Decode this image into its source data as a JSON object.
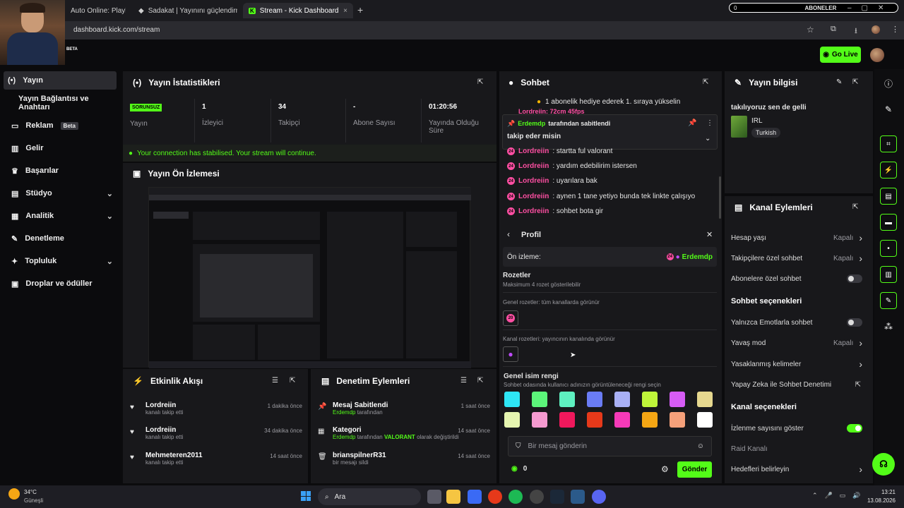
{
  "browser": {
    "tabs": [
      {
        "label": "Auto Online: Playli"
      },
      {
        "label": "Sadakat | Yayınını güçlendirmek"
      },
      {
        "label": "Stream - Kick Dashboard"
      }
    ],
    "url": "dashboard.kick.com/stream",
    "subscriber_overlay": {
      "count": "0",
      "label": "ABONELER"
    }
  },
  "header": {
    "beta_label": "BETA",
    "go_live": "Go Live"
  },
  "sidenav": [
    {
      "label": "Yayın",
      "icon": "broadcast-icon"
    },
    {
      "label": "Yayın Bağlantısı ve Anahtarı"
    },
    {
      "label": "Reklam",
      "badge": "Beta",
      "icon": "ad-icon"
    },
    {
      "label": "Gelir",
      "icon": "revenue-icon"
    },
    {
      "label": "Başarılar",
      "icon": "trophy-icon"
    },
    {
      "label": "Stüdyo",
      "icon": "studio-icon"
    },
    {
      "label": "Analitik",
      "icon": "analytics-icon"
    },
    {
      "label": "Denetleme",
      "icon": "wrench-icon"
    },
    {
      "label": "Topluluk",
      "icon": "community-icon"
    },
    {
      "label": "Droplar ve ödüller",
      "icon": "drops-icon"
    }
  ],
  "stats": {
    "title": "Yayın İstatistikleri",
    "cells": [
      {
        "value": "SORUNSUZ",
        "label": "Yayın"
      },
      {
        "value": "1",
        "label": "İzleyici"
      },
      {
        "value": "34",
        "label": "Takipçi"
      },
      {
        "value": "-",
        "label": "Abone Sayısı"
      },
      {
        "value": "01:20:56",
        "label": "Yayında Olduğu Süre"
      }
    ],
    "connection": "Your connection has stabilised. Your stream will continue."
  },
  "preview": {
    "title": "Yayın Ön İzlemesi"
  },
  "activity": {
    "title": "Etkinlik Akışı",
    "items": [
      {
        "name": "Lordreiin",
        "action": "kanalı takip etti",
        "time": "1 dakika önce"
      },
      {
        "name": "Lordreiin",
        "action": "kanalı takip etti",
        "time": "34 dakika önce"
      },
      {
        "name": "Mehmeteren2011",
        "action": "kanalı takip etti",
        "time": "14 saat önce"
      }
    ]
  },
  "moderation": {
    "title": "Denetim Eylemleri",
    "items": [
      {
        "title": "Mesaj Sabitlendi",
        "by": "Erdemdp",
        "suffix": "tarafından",
        "time": "1 saat önce"
      },
      {
        "title": "Kategori",
        "by": "Erdemdp",
        "suffix": "tarafından",
        "cat": "VALORANT",
        "suffix2": "olarak değiştirildi",
        "time": "14 saat önce"
      },
      {
        "title": "brianspilnerR31",
        "detail": "bir mesajı sildi",
        "time": "14 saat önce"
      }
    ]
  },
  "chat": {
    "title": "Sohbet",
    "gift_banner": "1 abonelik hediye ederek 1. sıraya yükselin",
    "pinned_by_user": "Erdemdp",
    "pinned_by_suffix": "tarafından sabitlendi",
    "pinned_msg": "takip eder misin",
    "partial_top": "Lordreiin: 72cm 45fps",
    "messages": [
      {
        "user": "Lordreiin",
        "text": ": startta ful valorant"
      },
      {
        "user": "Lordreiin",
        "text": ": yardım edebilirim istersen"
      },
      {
        "user": "Lordreiin",
        "text": ": uyarılara bak"
      },
      {
        "user": "Lordreiin",
        "text": ": aynen 1 tane yetiyo bunda tek linkte çalışıyo"
      },
      {
        "user": "Lordreiin",
        "text": ": sohbet bota gir"
      }
    ],
    "badge_text": "24",
    "profile": {
      "title": "Profil",
      "preview_label": "Ön izleme:",
      "preview_user": "Erdemdp",
      "badges_title": "Rozetler",
      "badges_sub": "Maksimum 4 rozet gösterilebilir",
      "global_badges": "Genel rozetler: tüm kanallarda görünür",
      "global_badge_text": "20",
      "channel_badges": "Kanal rozetleri: yayıncının kanalında görünür",
      "color_title": "Genel isim rengi",
      "color_sub": "Sohbet odasında kullanıcı adınızın görüntüleneceği rengi seçin",
      "colors": [
        "#2ee6f5",
        "#5cf57a",
        "#5ef0c0",
        "#6a7cf5",
        "#a9b0f5",
        "#bff53a",
        "#d65cf5",
        "#e6d88f",
        "#e6f5b0",
        "#f59ad0",
        "#f0185c",
        "#e6391a",
        "#f53ab8",
        "#f5a614",
        "#f5a07a",
        "#ffffff"
      ]
    },
    "input_placeholder": "Bir mesaj gönderin",
    "points": "0",
    "send": "Gönder"
  },
  "info": {
    "title": "Yayın bilgisi",
    "stream_title": "takılıyoruz sen de gelli",
    "category": "IRL",
    "tag": "Turkish"
  },
  "channel_actions": {
    "title": "Kanal Eylemleri",
    "rows": [
      {
        "label": "Hesap yaşı",
        "value": "Kapalı",
        "type": "chevron"
      },
      {
        "label": "Takipçilere özel sohbet",
        "value": "Kapalı",
        "type": "chevron"
      },
      {
        "label": "Abonelere özel sohbet",
        "type": "toggle",
        "on": false
      }
    ],
    "chat_section": "Sohbet seçenekleri",
    "chat_rows": [
      {
        "label": "Yalnızca Emotlarla sohbet",
        "type": "toggle",
        "on": false
      },
      {
        "label": "Yavaş mod",
        "value": "Kapalı",
        "type": "chevron"
      },
      {
        "label": "Yasaklanmış kelimeler",
        "type": "chevron"
      },
      {
        "label": "Yapay Zeka ile Sohbet Denetimi",
        "type": "external"
      }
    ],
    "channel_section": "Kanal seçenekleri",
    "channel_rows": [
      {
        "label": "İzlenme sayısını göster",
        "type": "toggle",
        "on": true
      },
      {
        "label": "Raid Kanalı",
        "type": "none",
        "muted": true
      },
      {
        "label": "Hedefleri belirleyin",
        "type": "chevron"
      }
    ]
  },
  "taskbar": {
    "weather_temp": "34°C",
    "weather_desc": "Güneşli",
    "search": "Ara",
    "time": "13:21",
    "date": "13.08.2026"
  },
  "colors": {
    "accent": "#53fc18",
    "username": "#ff4fa3",
    "panel": "#18181b"
  }
}
